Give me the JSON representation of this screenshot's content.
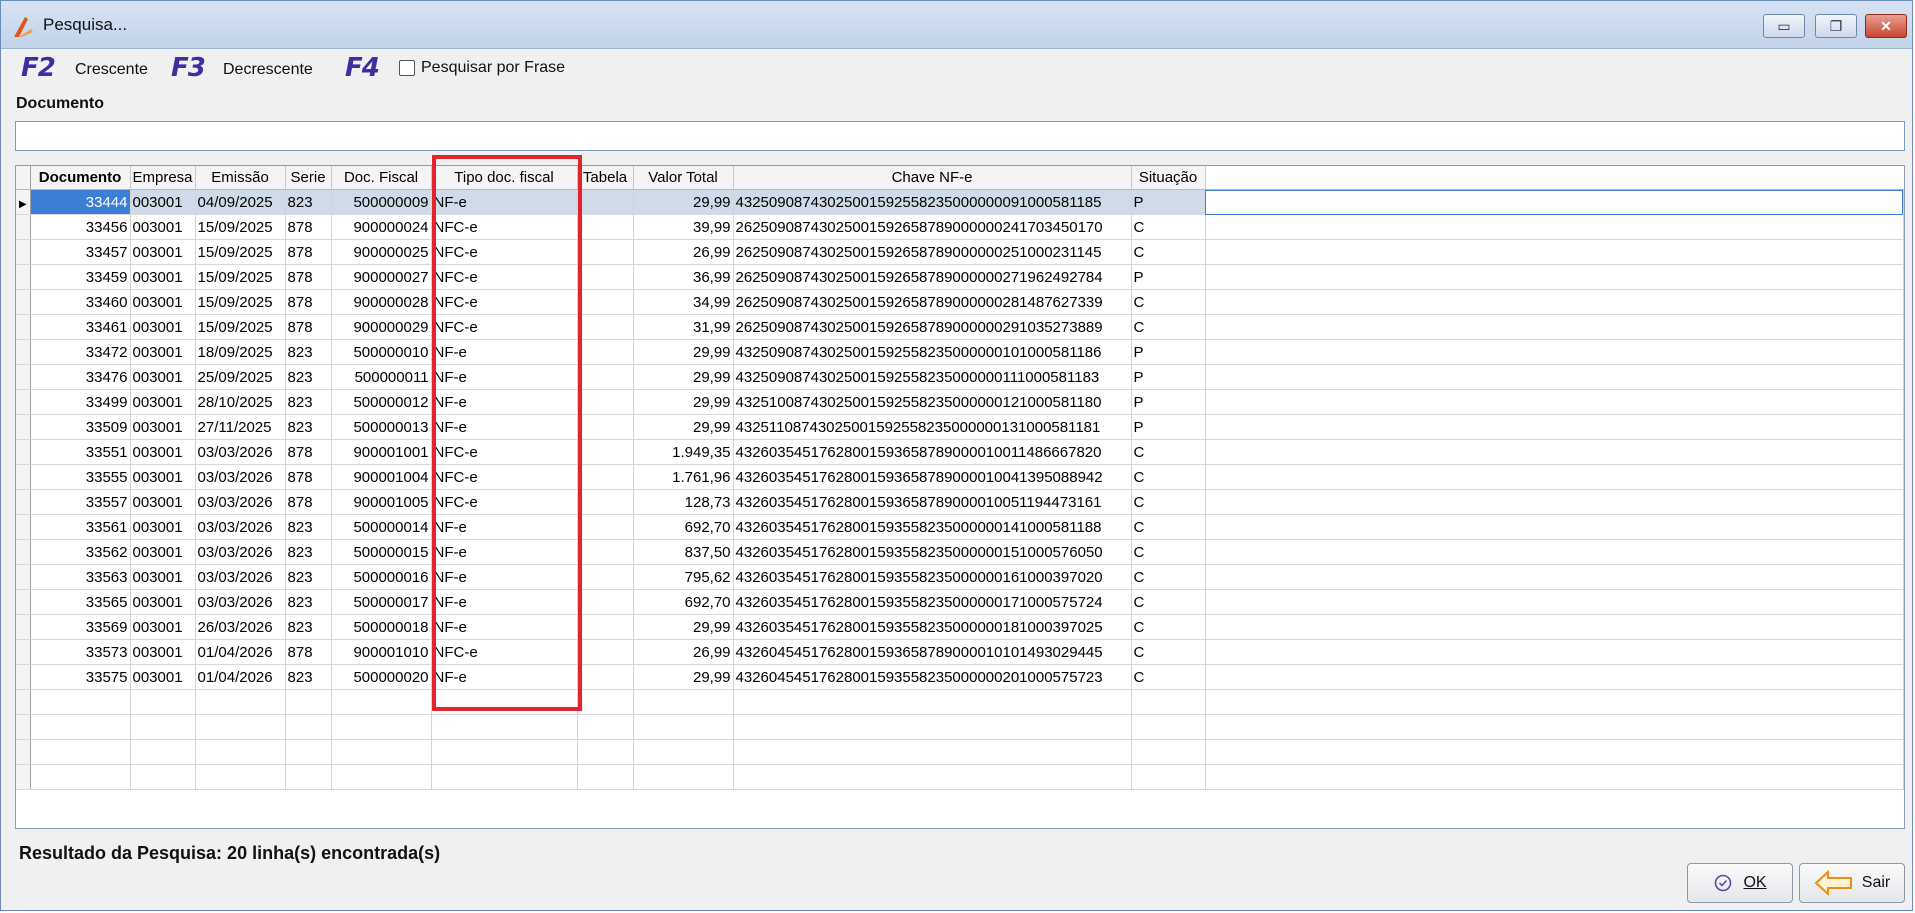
{
  "window": {
    "title": "Pesquisa...",
    "min_label": "▭",
    "max_label": "❐",
    "close_label": "✕"
  },
  "toolbar": {
    "f2_key": "F2",
    "f2_label": "Crescente",
    "f3_key": "F3",
    "f3_label": "Decrescente",
    "f4_key": "F4",
    "f4_label": "Pesquisar por Frase",
    "f4_checked": false
  },
  "search": {
    "label": "Documento",
    "value": ""
  },
  "grid": {
    "columns": [
      "Documento",
      "Empresa",
      "Emissão",
      "Serie",
      "Doc. Fiscal",
      "Tipo doc. fiscal",
      "Tabela",
      "Valor Total",
      "Chave NF-e",
      "Situação"
    ],
    "rows": [
      [
        "33444",
        "003001",
        "04/09/2025",
        "823",
        "500000009",
        "NF-e",
        "",
        "29,99",
        "43250908743025001592558235000000091000581185",
        "P"
      ],
      [
        "33456",
        "003001",
        "15/09/2025",
        "878",
        "900000024",
        "NFC-e",
        "",
        "39,99",
        "26250908743025001592658789000000241703450170",
        "C"
      ],
      [
        "33457",
        "003001",
        "15/09/2025",
        "878",
        "900000025",
        "NFC-e",
        "",
        "26,99",
        "26250908743025001592658789000000251000231145",
        "C"
      ],
      [
        "33459",
        "003001",
        "15/09/2025",
        "878",
        "900000027",
        "NFC-e",
        "",
        "36,99",
        "26250908743025001592658789000000271962492784",
        "P"
      ],
      [
        "33460",
        "003001",
        "15/09/2025",
        "878",
        "900000028",
        "NFC-e",
        "",
        "34,99",
        "26250908743025001592658789000000281487627339",
        "C"
      ],
      [
        "33461",
        "003001",
        "15/09/2025",
        "878",
        "900000029",
        "NFC-e",
        "",
        "31,99",
        "26250908743025001592658789000000291035273889",
        "C"
      ],
      [
        "33472",
        "003001",
        "18/09/2025",
        "823",
        "500000010",
        "NF-e",
        "",
        "29,99",
        "43250908743025001592558235000000101000581186",
        "P"
      ],
      [
        "33476",
        "003001",
        "25/09/2025",
        "823",
        "500000011",
        "NF-e",
        "",
        "29,99",
        "43250908743025001592558235000000111000581183",
        "P"
      ],
      [
        "33499",
        "003001",
        "28/10/2025",
        "823",
        "500000012",
        "NF-e",
        "",
        "29,99",
        "43251008743025001592558235000000121000581180",
        "P"
      ],
      [
        "33509",
        "003001",
        "27/11/2025",
        "823",
        "500000013",
        "NF-e",
        "",
        "29,99",
        "43251108743025001592558235000000131000581181",
        "P"
      ],
      [
        "33551",
        "003001",
        "03/03/2026",
        "878",
        "900001001",
        "NFC-e",
        "",
        "1.949,35",
        "43260354517628001593658789000010011486667820",
        "C"
      ],
      [
        "33555",
        "003001",
        "03/03/2026",
        "878",
        "900001004",
        "NFC-e",
        "",
        "1.761,96",
        "43260354517628001593658789000010041395088942",
        "C"
      ],
      [
        "33557",
        "003001",
        "03/03/2026",
        "878",
        "900001005",
        "NFC-e",
        "",
        "128,73",
        "43260354517628001593658789000010051194473161",
        "C"
      ],
      [
        "33561",
        "003001",
        "03/03/2026",
        "823",
        "500000014",
        "NF-e",
        "",
        "692,70",
        "43260354517628001593558235000000141000581188",
        "C"
      ],
      [
        "33562",
        "003001",
        "03/03/2026",
        "823",
        "500000015",
        "NF-e",
        "",
        "837,50",
        "43260354517628001593558235000000151000576050",
        "C"
      ],
      [
        "33563",
        "003001",
        "03/03/2026",
        "823",
        "500000016",
        "NF-e",
        "",
        "795,62",
        "43260354517628001593558235000000161000397020",
        "C"
      ],
      [
        "33565",
        "003001",
        "03/03/2026",
        "823",
        "500000017",
        "NF-e",
        "",
        "692,70",
        "43260354517628001593558235000000171000575724",
        "C"
      ],
      [
        "33569",
        "003001",
        "26/03/2026",
        "823",
        "500000018",
        "NF-e",
        "",
        "29,99",
        "43260354517628001593558235000000181000397025",
        "C"
      ],
      [
        "33573",
        "003001",
        "01/04/2026",
        "878",
        "900001010",
        "NFC-e",
        "",
        "26,99",
        "43260454517628001593658789000010101493029445",
        "C"
      ],
      [
        "33575",
        "003001",
        "01/04/2026",
        "823",
        "500000020",
        "NF-e",
        "",
        "29,99",
        "43260454517628001593558235000000201000575723",
        "C"
      ]
    ],
    "selected_row": 0,
    "empty_rows": 4
  },
  "status": {
    "text": "Resultado da Pesquisa: 20 linha(s) encontrada(s)"
  },
  "buttons": {
    "ok_label": "OK",
    "exit_label": "Sair"
  },
  "colors": {
    "highlight_box": "#e3242b",
    "fkey": "#3d2fa0",
    "selection": "#3c7fd6"
  }
}
